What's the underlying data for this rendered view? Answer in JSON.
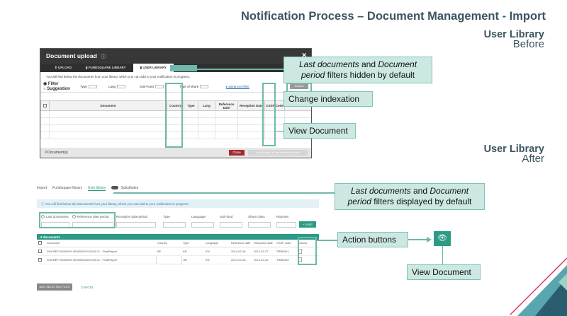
{
  "slide": {
    "title": "Notification Process – Document Management - Import",
    "before_title": "User Library",
    "before_sub": "Before",
    "after_title": "User Library",
    "after_sub": "After"
  },
  "before": {
    "window_title": "Document upload",
    "info_icon": "ⓘ",
    "close_icon": "✕",
    "tabs": [
      {
        "label": "⬆ UPLOAD"
      },
      {
        "label": "▮ FUNDSQUARE LIBRARY"
      },
      {
        "label": "▮ USER LIBRARY"
      }
    ],
    "info_text": "You will find below the documents from your library, which you can add to your notification in progress.",
    "filter_label": "Filter",
    "suggestion_label": "Suggestion",
    "filter_type": "Type",
    "filter_lang": "Lang",
    "filter_subfund": "Sub-Fund",
    "filter_share": "Type of share",
    "advanced_filter": "advanced filter",
    "search_btn": "Search",
    "columns": [
      "",
      "Document",
      "Country",
      "Type",
      "Lang",
      "Reference Date",
      "Reception Date",
      "CSSF Code",
      "Action"
    ],
    "footer_count": "0 Document(s)",
    "close_btn": "Close",
    "add_current_btn": "Add 0 file(s) to the current process"
  },
  "after": {
    "tabs": [
      "Import",
      "Fundsquare library",
      "User library"
    ],
    "toggle_label": "Substitutes",
    "info_text": "You will find below the documents from your library, which you can add to your notification in progress",
    "radio_last": "Last documents",
    "radio_period": "Reference date period",
    "labels": [
      "Reception date period",
      "Type",
      "Language",
      "Sub-fund",
      "Share class",
      "Reporter"
    ],
    "sort_btn": "SORT",
    "grid_count": "2 documents",
    "columns": [
      "",
      "Document",
      "Country",
      "Type",
      "Language",
      "Reference date",
      "Reception date",
      "CSSF code",
      "Actions"
    ],
    "rows": [
      {
        "doc": "DOCREF 00000001 0000000001/2015-01 - FinalReport",
        "country": "BE",
        "type": "AR",
        "lang": "EN",
        "ref": "2014-02-18",
        "rec": "2014-02-27",
        "code": "TRBD001",
        "action": "⋮"
      },
      {
        "doc": "DOCREF 00000002 0000000002/2015-01 - FinalReport",
        "country": "",
        "type": "AR",
        "lang": "EN",
        "ref": "2014-03-18",
        "rec": "2014-03-30",
        "code": "TRBD002",
        "action": "⋮"
      }
    ],
    "add_selected_btn": "ADD SELECTED FILES",
    "cancel_btn": "CANCEL"
  },
  "callouts": {
    "c1_italic1": "Last documents",
    "c1_mid": " and ",
    "c1_italic2": "Document",
    "c1_line2_italic": "period",
    "c1_line2_rest": " filters hidden by default",
    "c2": "Change indexation",
    "c3": "View Document",
    "c4_italic1": "Last documents",
    "c4_mid": " and ",
    "c4_italic2": "Document",
    "c4_line2_italic": "period",
    "c4_line2_rest": " filters displayed by default",
    "c5": "Action buttons",
    "c6": "View Document",
    "eye_icon": "👁"
  },
  "colors": {
    "accent": "#6fb8ab",
    "callout_bg": "#cde8e2",
    "header_text": "#3c5560",
    "teal": "#2c9b86"
  }
}
